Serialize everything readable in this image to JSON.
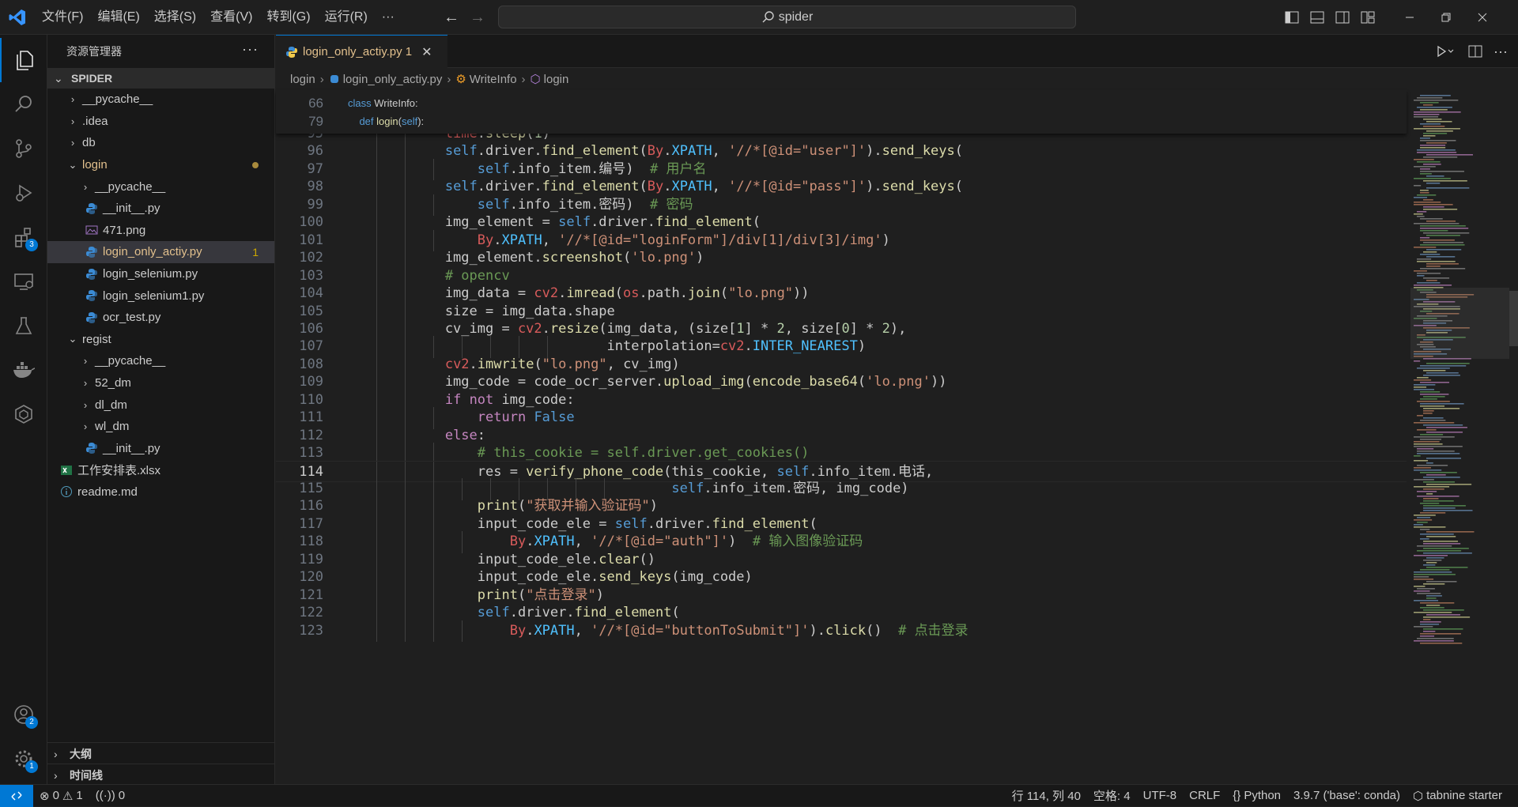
{
  "menu": [
    "文件(F)",
    "编辑(E)",
    "选择(S)",
    "查看(V)",
    "转到(G)",
    "运行(R)",
    "···"
  ],
  "search": {
    "text": "spider"
  },
  "activity_badges": {
    "extensions": "3",
    "accounts": "2",
    "manage": "1"
  },
  "sidebar": {
    "title": "资源管理器",
    "more": "···",
    "section": "SPIDER",
    "tree": [
      {
        "label": "__pycache__",
        "type": "folder"
      },
      {
        "label": ".idea",
        "type": "folder"
      },
      {
        "label": "db",
        "type": "folder"
      },
      {
        "label": "login",
        "type": "folder-open"
      },
      {
        "label": "__pycache__",
        "type": "folder"
      },
      {
        "label": "__init__.py",
        "type": "py"
      },
      {
        "label": "471.png",
        "type": "png"
      },
      {
        "label": "login_only_actiy.py",
        "type": "py",
        "badge": "1"
      },
      {
        "label": "login_selenium.py",
        "type": "py"
      },
      {
        "label": "login_selenium1.py",
        "type": "py"
      },
      {
        "label": "ocr_test.py",
        "type": "py"
      },
      {
        "label": "regist",
        "type": "folder-open"
      },
      {
        "label": "__pycache__",
        "type": "folder"
      },
      {
        "label": "52_dm",
        "type": "folder"
      },
      {
        "label": "dl_dm",
        "type": "folder"
      },
      {
        "label": "wl_dm",
        "type": "folder"
      },
      {
        "label": "__init__.py",
        "type": "py"
      },
      {
        "label": "工作安排表.xlsx",
        "type": "xlsx"
      },
      {
        "label": "readme.md",
        "type": "md"
      }
    ],
    "outline": "大纲",
    "timeline": "时间线"
  },
  "tab": {
    "label": "login_only_actiy.py 1",
    "close": "✕"
  },
  "breadcrumb": [
    "login",
    "login_only_actiy.py",
    "WriteInfo",
    "login"
  ],
  "sticky": [
    {
      "num": "66",
      "code": "class WriteInfo:"
    },
    {
      "num": "79",
      "code": "    def login(self):"
    }
  ],
  "code_lines": [
    {
      "num": "95",
      "code": "            time.sleep(1)"
    },
    {
      "num": "96",
      "code": "            self.driver.find_element(By.XPATH, '//*[@id=\"user\"]').send_keys("
    },
    {
      "num": "97",
      "code": "                self.info_item.编号)  # 用户名"
    },
    {
      "num": "98",
      "code": "            self.driver.find_element(By.XPATH, '//*[@id=\"pass\"]').send_keys("
    },
    {
      "num": "99",
      "code": "                self.info_item.密码)  # 密码"
    },
    {
      "num": "100",
      "code": "            img_element = self.driver.find_element("
    },
    {
      "num": "101",
      "code": "                By.XPATH, '//*[@id=\"loginForm\"]/div[1]/div[3]/img')"
    },
    {
      "num": "102",
      "code": "            img_element.screenshot('lo.png')"
    },
    {
      "num": "103",
      "code": "            # opencv"
    },
    {
      "num": "104",
      "code": "            img_data = cv2.imread(os.path.join(\"lo.png\"))"
    },
    {
      "num": "105",
      "code": "            size = img_data.shape"
    },
    {
      "num": "106",
      "code": "            cv_img = cv2.resize(img_data, (size[1] * 2, size[0] * 2),"
    },
    {
      "num": "107",
      "code": "                                interpolation=cv2.INTER_NEAREST)"
    },
    {
      "num": "108",
      "code": "            cv2.imwrite(\"lo.png\", cv_img)"
    },
    {
      "num": "109",
      "code": "            img_code = code_ocr_server.upload_img(encode_base64('lo.png'))"
    },
    {
      "num": "110",
      "code": "            if not img_code:"
    },
    {
      "num": "111",
      "code": "                return False"
    },
    {
      "num": "112",
      "code": "            else:"
    },
    {
      "num": "113",
      "code": "                # this_cookie = self.driver.get_cookies()"
    },
    {
      "num": "114",
      "code": "                res = verify_phone_code(this_cookie, self.info_item.电话,"
    },
    {
      "num": "115",
      "code": "                                        self.info_item.密码, img_code)"
    },
    {
      "num": "116",
      "code": "                print(\"获取并输入验证码\")"
    },
    {
      "num": "117",
      "code": "                input_code_ele = self.driver.find_element("
    },
    {
      "num": "118",
      "code": "                    By.XPATH, '//*[@id=\"auth\"]')  # 输入图像验证码"
    },
    {
      "num": "119",
      "code": "                input_code_ele.clear()"
    },
    {
      "num": "120",
      "code": "                input_code_ele.send_keys(img_code)"
    },
    {
      "num": "121",
      "code": "                print(\"点击登录\")"
    },
    {
      "num": "122",
      "code": "                self.driver.find_element("
    },
    {
      "num": "123",
      "code": "                    By.XPATH, '//*[@id=\"buttonToSubmit\"]').click()  # 点击登录"
    }
  ],
  "status": {
    "errors": "0",
    "warnings": "1",
    "ports": "0",
    "position": "行 114, 列 40",
    "spaces": "空格: 4",
    "encoding": "UTF-8",
    "eol": "CRLF",
    "language": "Python",
    "interpreter": "3.9.7 ('base': conda)",
    "tabnine": "tabnine starter"
  },
  "colors": {
    "accent": "#0078d4",
    "modified": "#e2c08d",
    "background": "#1f1f1f"
  }
}
